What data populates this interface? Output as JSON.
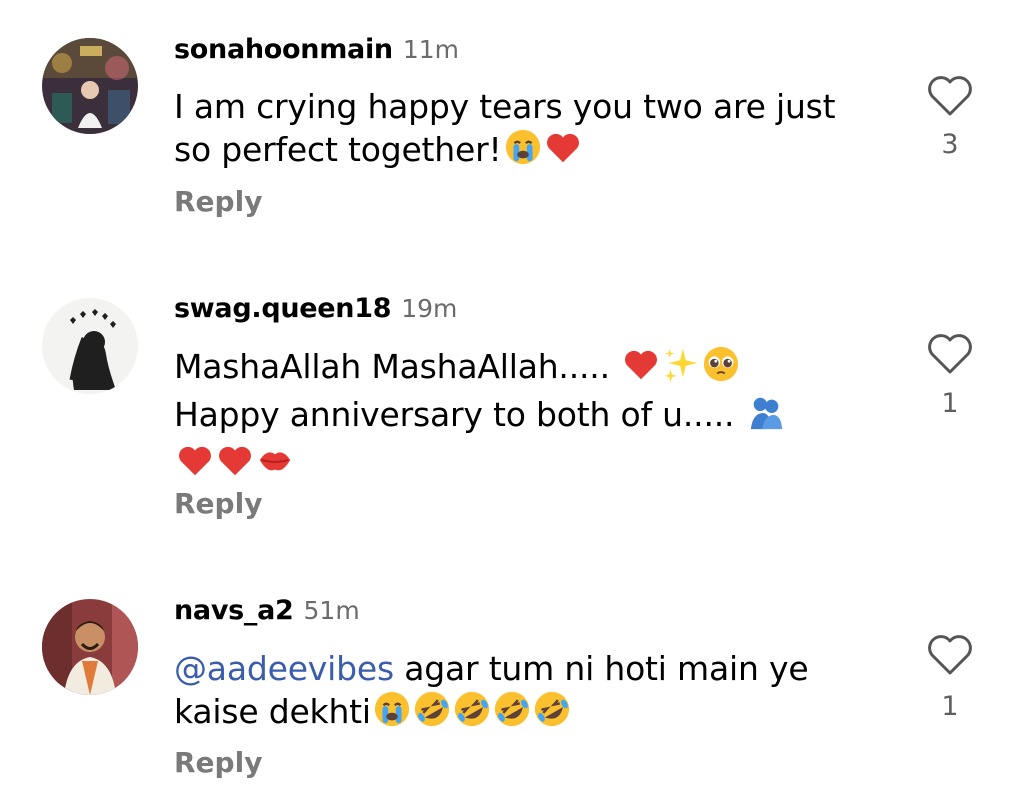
{
  "comments": [
    {
      "username": "sonahoonmain",
      "time": "11m",
      "lines": [
        "I am crying happy tears you two are just",
        "so perfect together!"
      ],
      "line_emojis": [
        [],
        [
          "loudly-crying-face",
          "red-heart"
        ]
      ],
      "reply_label": "Reply",
      "likes": "3"
    },
    {
      "username": "swag.queen18",
      "time": "19m",
      "lines": [
        "MashaAllah MashaAllah.....",
        "Happy anniversary to both of u.....",
        ""
      ],
      "line_emojis": [
        [
          "red-heart",
          "sparkles",
          "pleading-face"
        ],
        [
          "people-hugging"
        ],
        [
          "red-heart",
          "red-heart",
          "kiss-mark"
        ]
      ],
      "reply_label": "Reply",
      "likes": "1"
    },
    {
      "username": "navs_a2",
      "time": "51m",
      "mention": "@aadeevibes",
      "lines": [
        " agar tum ni hoti main ye",
        "kaise dekhti"
      ],
      "line_emojis": [
        [],
        [
          "loudly-crying-face",
          "rofl-face",
          "rofl-face",
          "rofl-face",
          "rofl-face"
        ]
      ],
      "reply_label": "Reply",
      "likes": "1"
    }
  ],
  "colors": {
    "username": "#000000",
    "timestamp": "#6b6b6b",
    "reply": "#7a7a7a",
    "mention": "#3b5dab",
    "heart_outline": "#555555"
  }
}
